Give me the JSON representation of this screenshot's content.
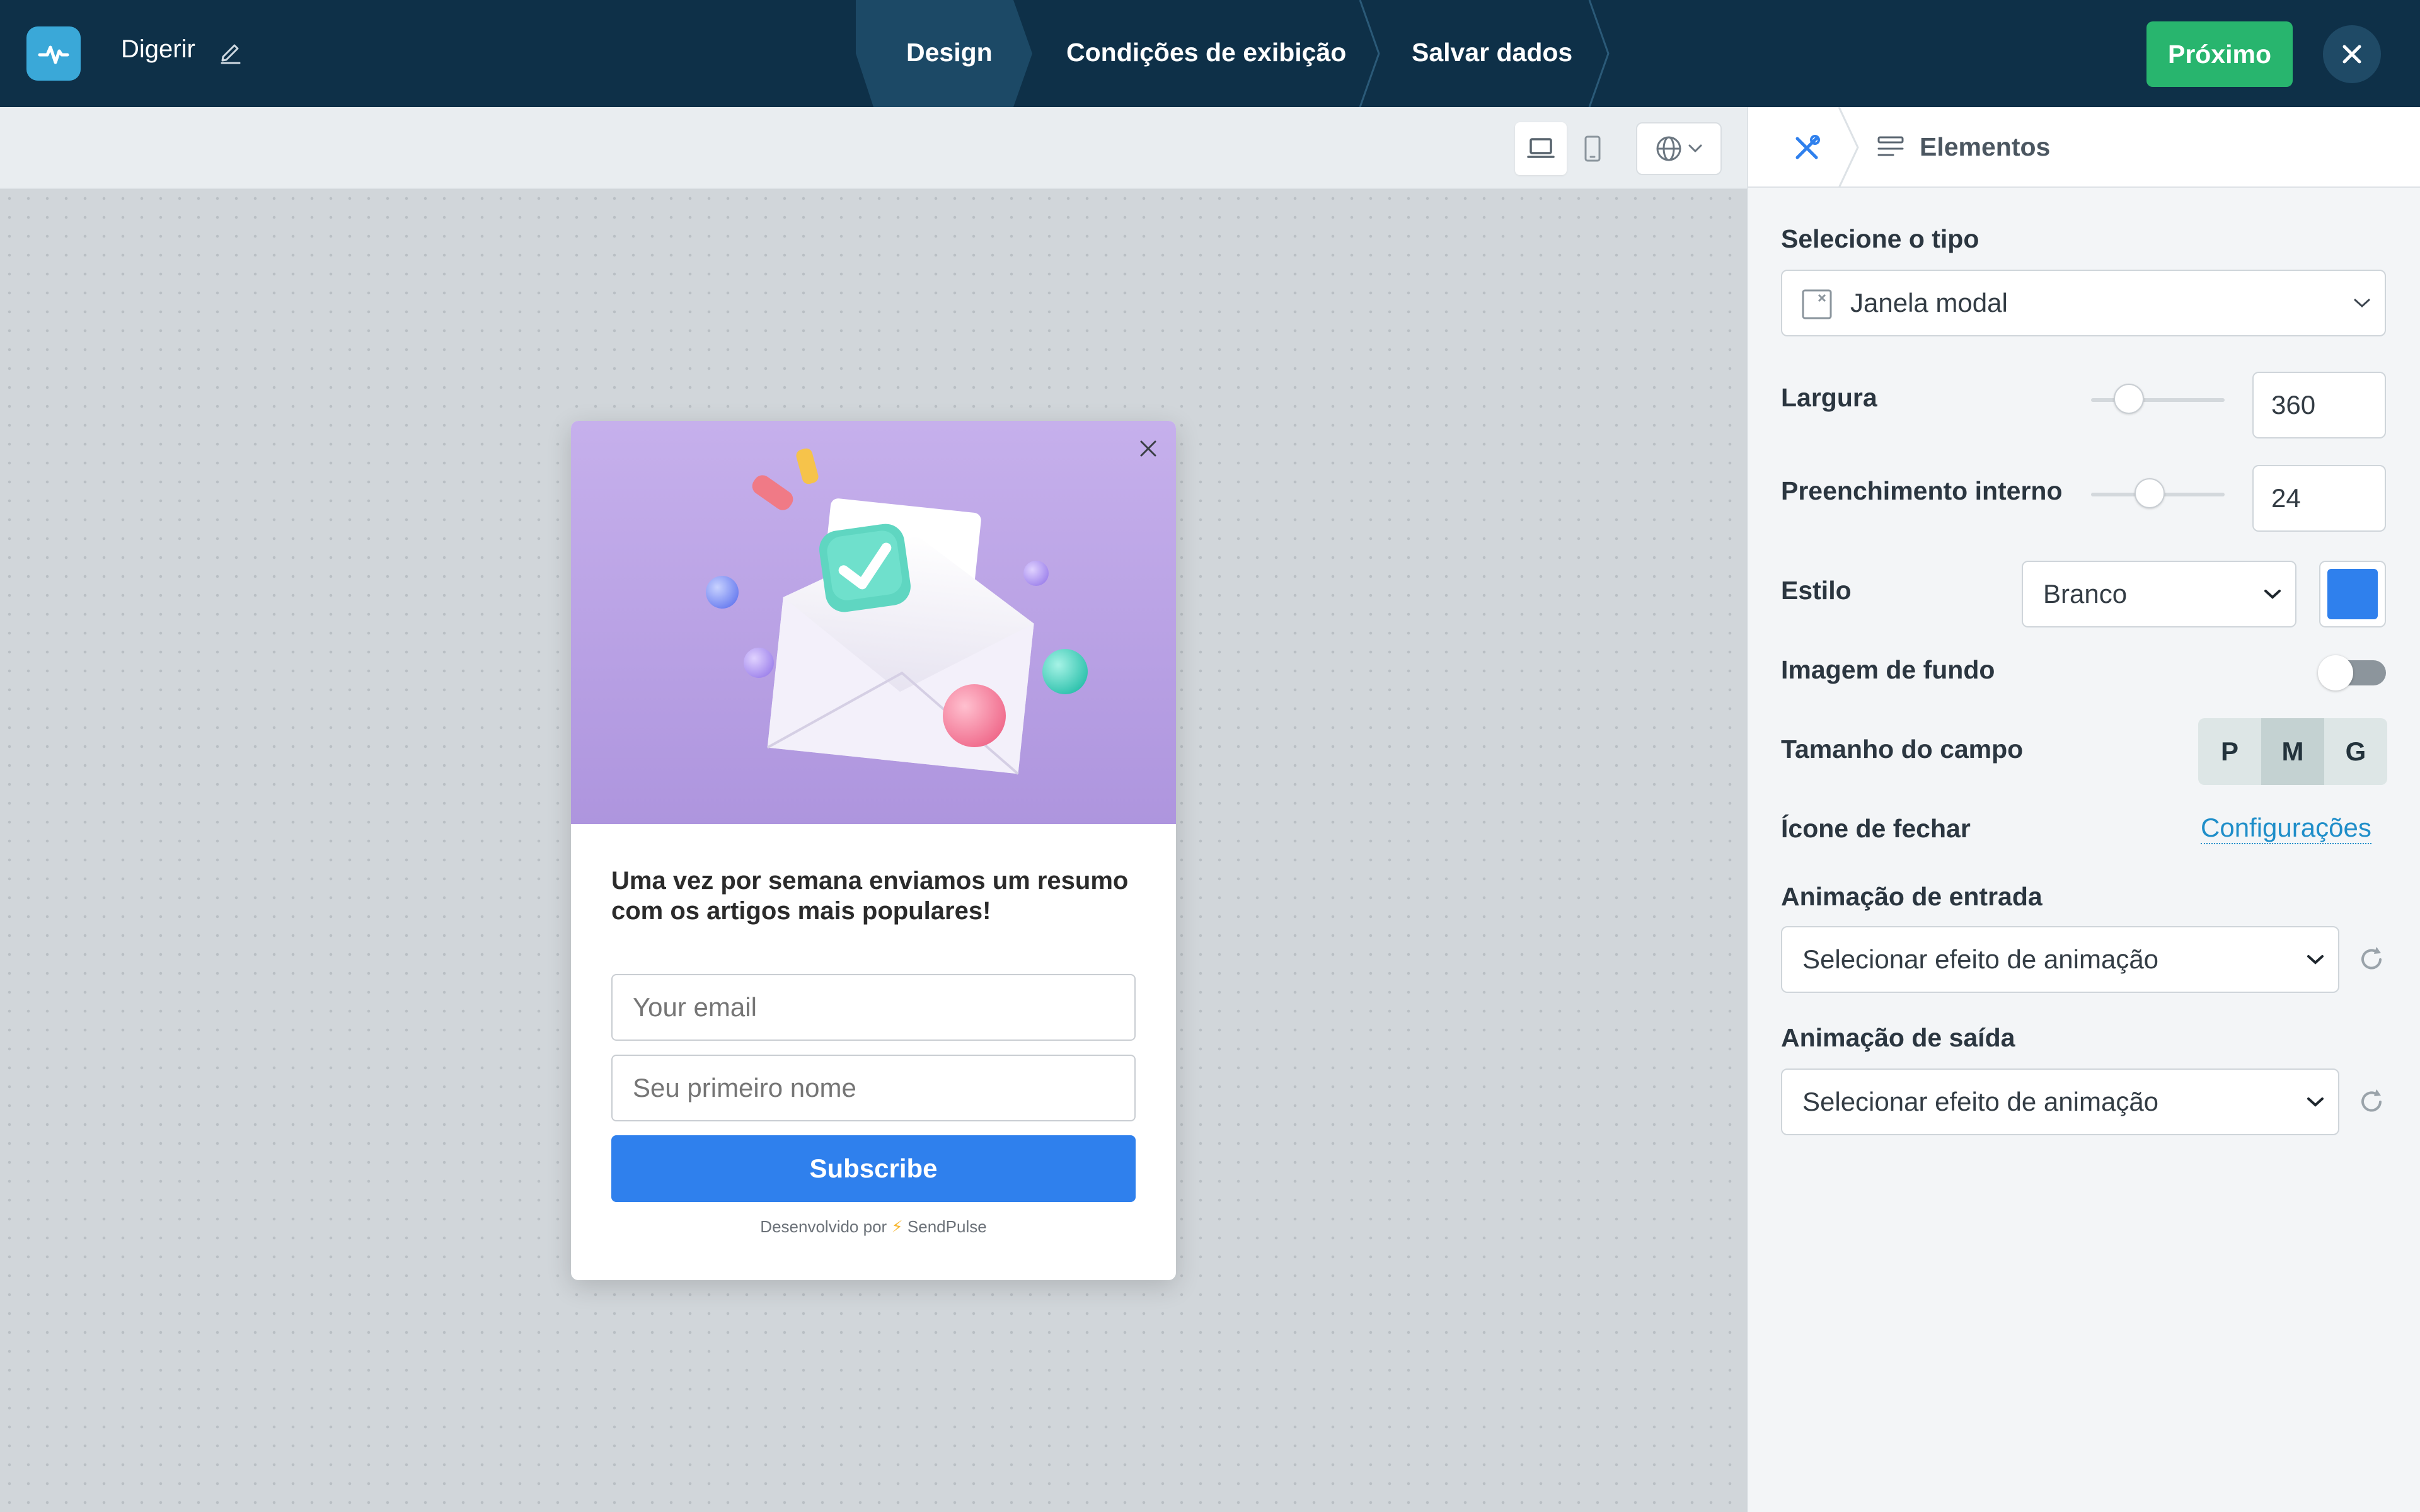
{
  "header": {
    "project_name": "Digerir",
    "steps": [
      {
        "label": "Design",
        "active": true
      },
      {
        "label": "Condições de exibição",
        "active": false
      },
      {
        "label": "Salvar dados",
        "active": false
      }
    ],
    "next_label": "Próximo"
  },
  "canvas": {
    "device_options": [
      "desktop-icon",
      "mobile-icon"
    ],
    "language_icon": "globe-icon"
  },
  "popup": {
    "message": "Uma vez por semana enviamos um resumo com os artigos mais populares!",
    "email_placeholder": "Your email",
    "name_placeholder": "Seu primeiro nome",
    "submit_label": "Subscribe",
    "powered_prefix": "Desenvolvido por",
    "powered_brand": "SendPulse"
  },
  "panel": {
    "tab_label": "Elementos",
    "type_label": "Selecione o tipo",
    "type_value": "Janela modal",
    "width_label": "Largura",
    "width_value": "360",
    "width_fraction": 0.22,
    "padding_label": "Preenchimento interno",
    "padding_value": "24",
    "padding_fraction": 0.42,
    "style_label": "Estilo",
    "style_value": "Branco",
    "style_color": "#2f80ed",
    "bg_image_label": "Imagem de fundo",
    "bg_image_enabled": false,
    "field_size_label": "Tamanho do campo",
    "field_sizes": [
      "P",
      "M",
      "G"
    ],
    "field_size_selected": "M",
    "close_icon_label": "Ícone de fechar",
    "close_icon_link": "Configurações",
    "entry_anim_label": "Animação de entrada",
    "entry_anim_value": "Selecionar efeito de animação",
    "exit_anim_label": "Animação de saída",
    "exit_anim_value": "Selecionar efeito de animação"
  },
  "colors": {
    "topbar": "#0e3048",
    "accent_green": "#28b56e",
    "accent_blue": "#2f80ed",
    "link": "#1f8ec9"
  }
}
